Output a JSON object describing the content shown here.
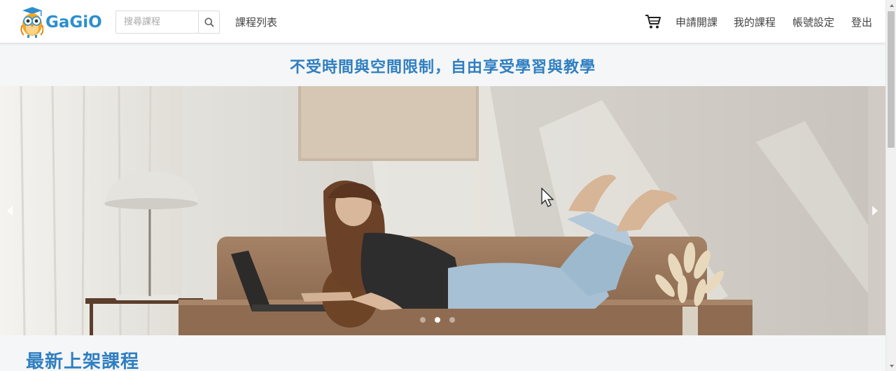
{
  "brand": {
    "name": "GaGiO",
    "logo_icon": "owl-logo-icon"
  },
  "search": {
    "placeholder": "搜尋課程",
    "value": "",
    "icon": "search-icon"
  },
  "nav": {
    "course_list": "課程列表",
    "cart_icon": "cart-icon",
    "apply_course": "申請開課",
    "my_courses": "我的課程",
    "account_settings": "帳號設定",
    "logout": "登出"
  },
  "tagline": "不受時間與空間限制，自由享受學習與教學",
  "carousel": {
    "prev_icon": "chevron-left-icon",
    "next_icon": "chevron-right-icon",
    "slide_count": 3,
    "active_index": 1
  },
  "sections": {
    "latest_title": "最新上架課程"
  },
  "colors": {
    "accent": "#2f7fc1",
    "logo": "#2c8fce"
  }
}
